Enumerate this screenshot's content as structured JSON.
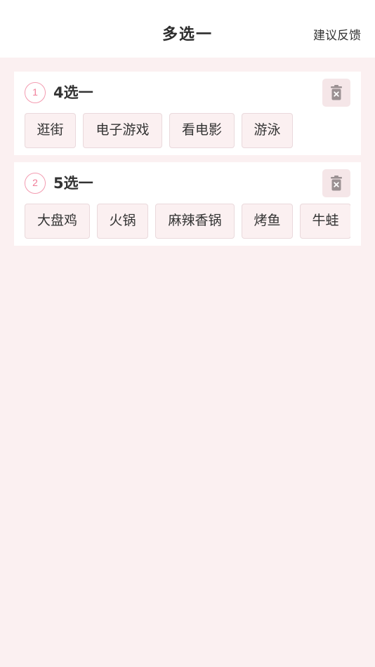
{
  "header": {
    "title": "多选一",
    "feedback_label": "建议反馈"
  },
  "groups": [
    {
      "index": "1",
      "title": "4选一",
      "options": [
        "逛街",
        "电子游戏",
        "看电影",
        "游泳"
      ]
    },
    {
      "index": "2",
      "title": "5选一",
      "options": [
        "大盘鸡",
        "火锅",
        "麻辣香锅",
        "烤鱼",
        "牛蛙"
      ]
    }
  ],
  "icons": {
    "delete": "trash-icon"
  },
  "colors": {
    "background": "#fbf0f1",
    "accent_pink": "#f07c98",
    "option_border": "#ead9dc",
    "trash_bg": "#f5e6e8"
  }
}
